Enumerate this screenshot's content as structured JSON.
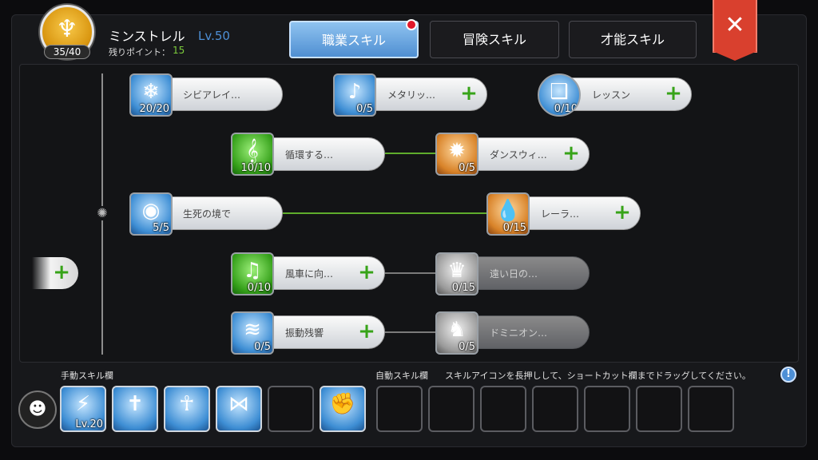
{
  "header": {
    "job_name": "ミンストレル",
    "job_level": "Lv.50",
    "points_label": "残りポイント：",
    "points_value": "15",
    "emblem_count": "35/40"
  },
  "tabs": [
    {
      "label": "職業スキル",
      "active": true,
      "has_notification": true
    },
    {
      "label": "冒険スキル",
      "active": false
    },
    {
      "label": "才能スキル",
      "active": false
    }
  ],
  "close_label": "✕",
  "skills": [
    {
      "name": "シビアレイ…",
      "level": "20/20",
      "icon": "ice-shards-icon",
      "color": "blue",
      "locked": false,
      "addable": false
    },
    {
      "name": "メタリッ…",
      "level": "0/5",
      "icon": "singing-voice-icon",
      "color": "blue",
      "locked": false,
      "addable": true
    },
    {
      "name": "レッスン",
      "level": "0/10",
      "icon": "open-book-icon",
      "color": "blue",
      "locked": false,
      "addable": true
    },
    {
      "name": "循環する…",
      "level": "10/10",
      "icon": "treble-clef-icon",
      "color": "green",
      "locked": false,
      "addable": false
    },
    {
      "name": "ダンスウィ…",
      "level": "0/5",
      "icon": "howling-wolf-icon",
      "color": "orange",
      "locked": false,
      "addable": true
    },
    {
      "name": "生死の境で",
      "level": "5/5",
      "icon": "fish-bubble-icon",
      "color": "blue",
      "locked": false,
      "addable": false
    },
    {
      "name": "レーラ…",
      "level": "0/15",
      "icon": "water-drop-icon",
      "color": "orange",
      "locked": false,
      "addable": true
    },
    {
      "name": "風車に向…",
      "level": "0/10",
      "icon": "music-notes-icon",
      "color": "green",
      "locked": false,
      "addable": true
    },
    {
      "name": "遠い日の…",
      "level": "0/15",
      "icon": "crowned-figure-icon",
      "color": "gray",
      "locked": true,
      "addable": false
    },
    {
      "name": "振動残響",
      "level": "0/5",
      "icon": "resonance-waves-icon",
      "color": "blue",
      "locked": false,
      "addable": true
    },
    {
      "name": "ドミニオン…",
      "level": "0/5",
      "icon": "winged-demon-icon",
      "color": "gray",
      "locked": true,
      "addable": false
    }
  ],
  "manual_bar": {
    "label": "手動スキル欄",
    "first_slot_level": "Lv.20",
    "slot_icons": [
      "lightning-burst-icon",
      "holy-circle-icon",
      "revival-icon",
      "ribbon-aura-icon",
      "",
      "raised-fist-icon"
    ]
  },
  "auto_bar": {
    "label": "自動スキル欄",
    "hint": "スキルアイコンを長押しして、ショートカット欄までドラッグしてください。",
    "slot_count": 7
  },
  "help_label": "!",
  "colors": {
    "accent_blue": "#4d8fd6",
    "add_green": "#37a318",
    "link_green": "#5fad2c",
    "close_red": "#d9402e",
    "points_green": "#7ccb3b"
  }
}
